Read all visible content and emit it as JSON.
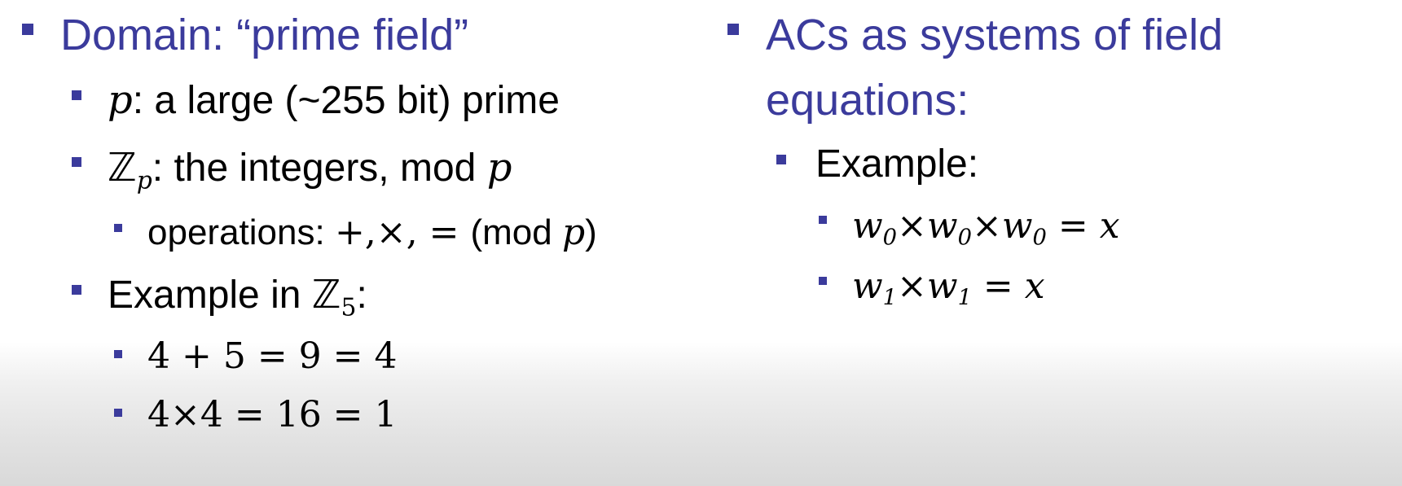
{
  "left": {
    "heading": "Domain: “prime field”",
    "item_p": {
      "symbol": "p",
      "text": ": a large (~255 bit) prime"
    },
    "item_zp": {
      "symbol": "ℤ",
      "sub": "p",
      "text": ": the integers, mod ",
      "var": "p"
    },
    "item_ops": {
      "text": "operations: ",
      "ops": "+,×, = ",
      "open": "(mod ",
      "var": "p",
      "close": ")"
    },
    "item_example": {
      "text": "Example in ",
      "symbol": "ℤ",
      "sub": "5",
      "colon": ":"
    },
    "eq1": "4 + 5 = 9 = 4",
    "eq2": "4×4 = 16 = 1"
  },
  "right": {
    "heading_line1": "ACs as systems of field",
    "heading_line2": "equations:",
    "example_label": "Example:",
    "eq1": {
      "w": "w",
      "s": "0",
      "times": "×",
      "rhs": " = ",
      "x": "x"
    },
    "eq2": {
      "w": "w",
      "s": "1",
      "times": "×",
      "rhs": " = ",
      "x": "x"
    }
  }
}
